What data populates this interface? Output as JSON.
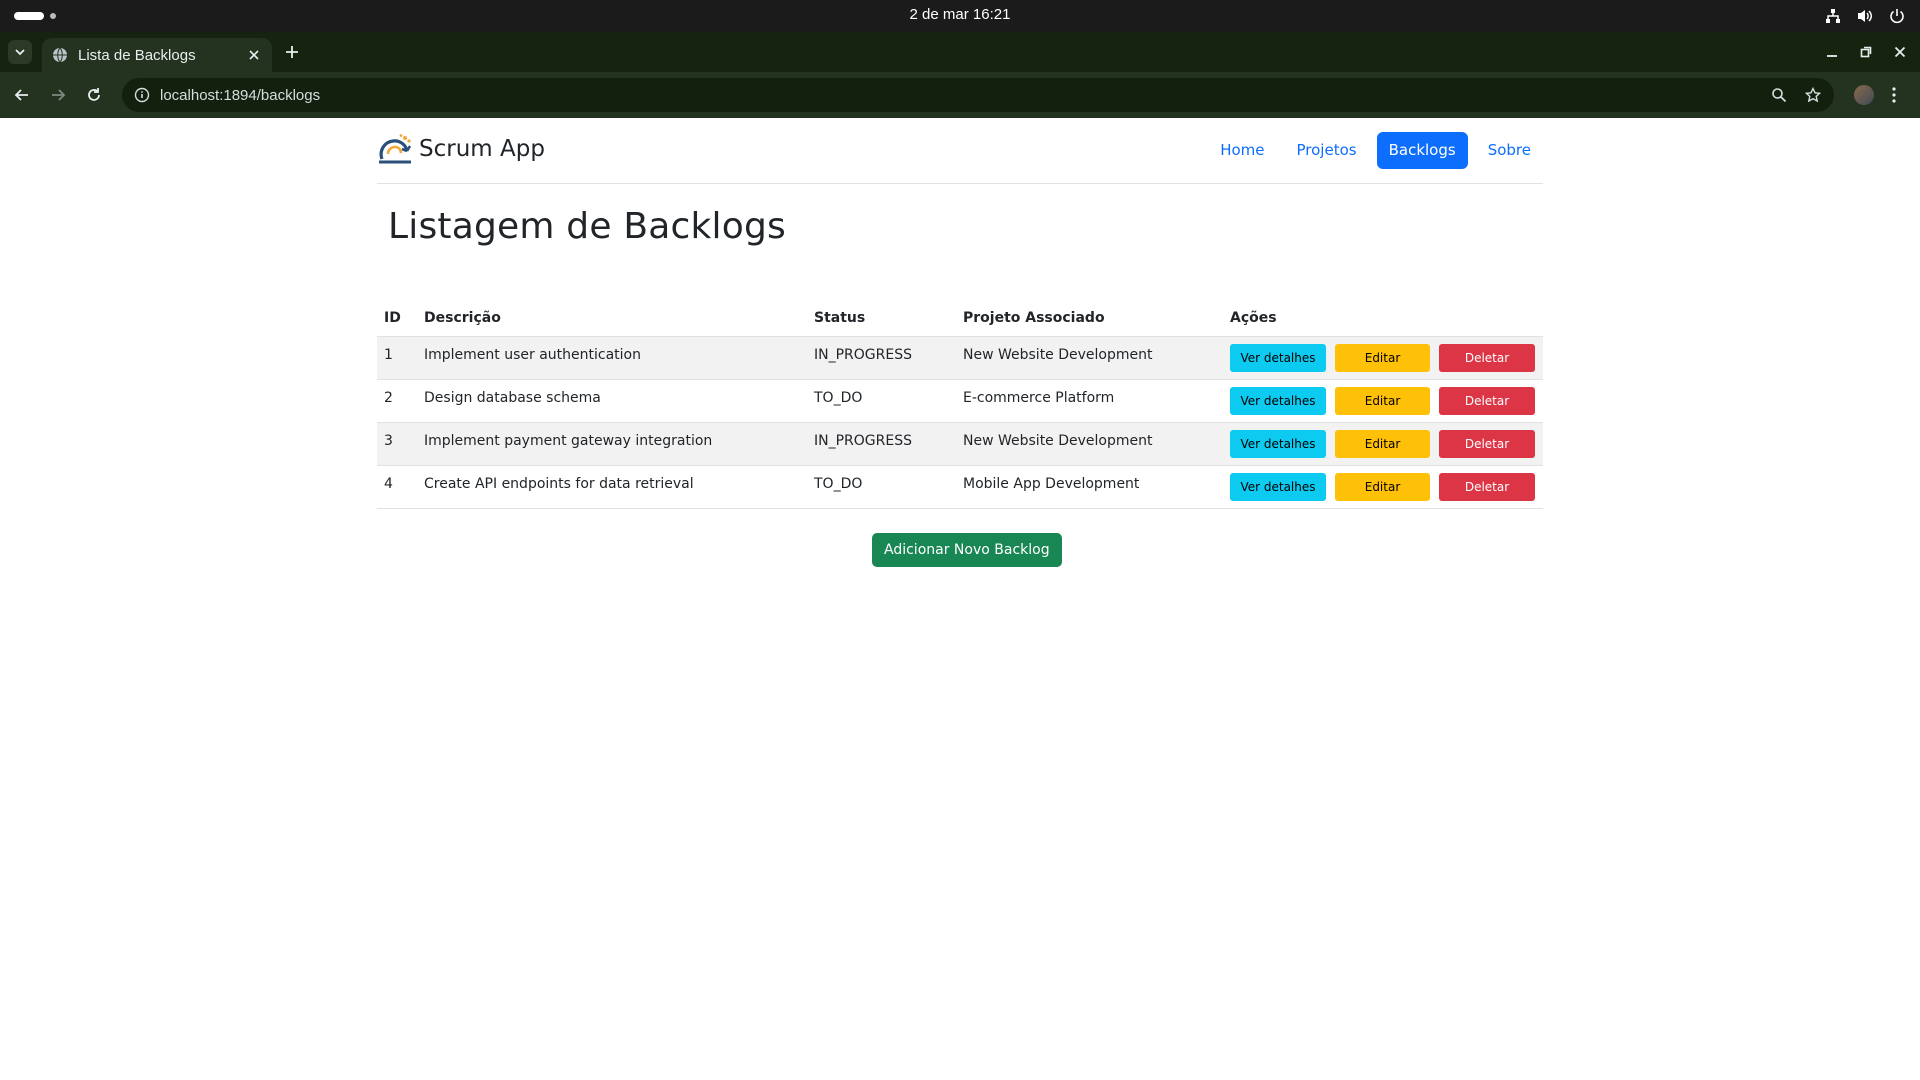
{
  "system": {
    "clock": "2 de mar  16:21"
  },
  "browser": {
    "tab_title": "Lista de Backlogs",
    "url": "localhost:1894/backlogs"
  },
  "navbar": {
    "brand": "Scrum App",
    "links": [
      {
        "label": "Home",
        "active": false
      },
      {
        "label": "Projetos",
        "active": false
      },
      {
        "label": "Backlogs",
        "active": true
      },
      {
        "label": "Sobre",
        "active": false
      }
    ]
  },
  "page": {
    "title": "Listagem de Backlogs",
    "add_button": "Adicionar Novo Backlog"
  },
  "table": {
    "headers": {
      "id": "ID",
      "description": "Descrição",
      "status": "Status",
      "project": "Projeto Associado",
      "actions": "Ações"
    },
    "action_labels": {
      "view": "Ver detalhes",
      "edit": "Editar",
      "delete": "Deletar"
    },
    "rows": [
      {
        "id": "1",
        "description": "Implement user authentication",
        "status": "IN_PROGRESS",
        "project": "New Website Development"
      },
      {
        "id": "2",
        "description": "Design database schema",
        "status": "TO_DO",
        "project": "E-commerce Platform"
      },
      {
        "id": "3",
        "description": "Implement payment gateway integration",
        "status": "IN_PROGRESS",
        "project": "New Website Development"
      },
      {
        "id": "4",
        "description": "Create API endpoints for data retrieval",
        "status": "TO_DO",
        "project": "Mobile App Development"
      }
    ]
  },
  "colors": {
    "primary": "#0d6efd",
    "info": "#0dcaf0",
    "warning": "#ffc107",
    "danger": "#dc3545",
    "success": "#198754",
    "browser_frame": "#243320"
  }
}
